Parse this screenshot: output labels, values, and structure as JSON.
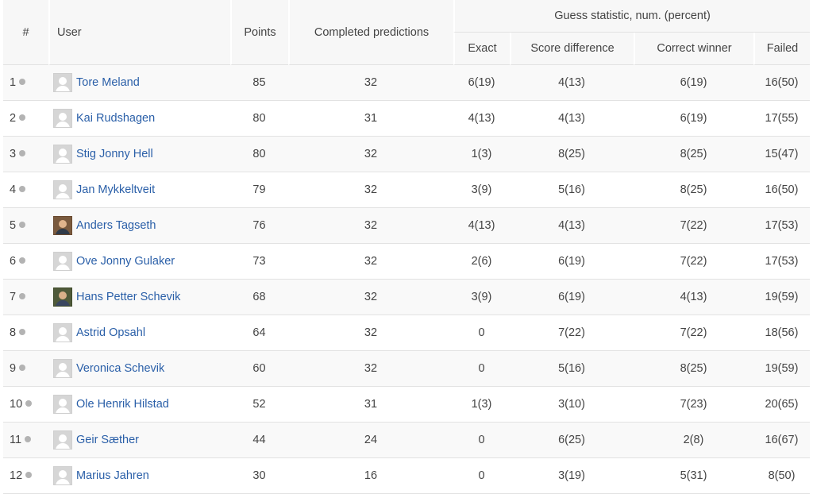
{
  "headers": {
    "rank": "#",
    "user": "User",
    "points": "Points",
    "completed": "Completed predictions",
    "group": "Guess statistic, num. (percent)",
    "exact": "Exact",
    "score_difference": "Score difference",
    "correct_winner": "Correct winner",
    "failed": "Failed"
  },
  "rows": [
    {
      "rank": "1",
      "name": "Tore Meland",
      "avatar": "default-avatar-icon",
      "points": "85",
      "completed": "32",
      "exact": "6(19)",
      "score_diff": "4(13)",
      "winner": "6(19)",
      "failed": "16(50)"
    },
    {
      "rank": "2",
      "name": "Kai Rudshagen",
      "avatar": "default-avatar-icon",
      "points": "80",
      "completed": "31",
      "exact": "4(13)",
      "score_diff": "4(13)",
      "winner": "6(19)",
      "failed": "17(55)"
    },
    {
      "rank": "3",
      "name": "Stig Jonny Hell",
      "avatar": "default-avatar-icon",
      "points": "80",
      "completed": "32",
      "exact": "1(3)",
      "score_diff": "8(25)",
      "winner": "8(25)",
      "failed": "15(47)"
    },
    {
      "rank": "4",
      "name": "Jan Mykkeltveit",
      "avatar": "default-avatar-icon",
      "points": "79",
      "completed": "32",
      "exact": "3(9)",
      "score_diff": "5(16)",
      "winner": "8(25)",
      "failed": "16(50)"
    },
    {
      "rank": "5",
      "name": "Anders Tagseth",
      "avatar": "user-photo",
      "points": "76",
      "completed": "32",
      "exact": "4(13)",
      "score_diff": "4(13)",
      "winner": "7(22)",
      "failed": "17(53)"
    },
    {
      "rank": "6",
      "name": "Ove Jonny Gulaker",
      "avatar": "default-avatar-icon",
      "points": "73",
      "completed": "32",
      "exact": "2(6)",
      "score_diff": "6(19)",
      "winner": "7(22)",
      "failed": "17(53)"
    },
    {
      "rank": "7",
      "name": "Hans Petter Schevik",
      "avatar": "user-photo-2",
      "points": "68",
      "completed": "32",
      "exact": "3(9)",
      "score_diff": "6(19)",
      "winner": "4(13)",
      "failed": "19(59)"
    },
    {
      "rank": "8",
      "name": "Astrid Opsahl",
      "avatar": "default-avatar-icon",
      "points": "64",
      "completed": "32",
      "exact": "0",
      "score_diff": "7(22)",
      "winner": "7(22)",
      "failed": "18(56)"
    },
    {
      "rank": "9",
      "name": "Veronica Schevik",
      "avatar": "default-avatar-icon",
      "points": "60",
      "completed": "32",
      "exact": "0",
      "score_diff": "5(16)",
      "winner": "8(25)",
      "failed": "19(59)"
    },
    {
      "rank": "10",
      "name": "Ole Henrik Hilstad",
      "avatar": "default-avatar-icon",
      "points": "52",
      "completed": "31",
      "exact": "1(3)",
      "score_diff": "3(10)",
      "winner": "7(23)",
      "failed": "20(65)"
    },
    {
      "rank": "11",
      "name": "Geir Sæther",
      "avatar": "default-avatar-icon",
      "points": "44",
      "completed": "24",
      "exact": "0",
      "score_diff": "6(25)",
      "winner": "2(8)",
      "failed": "16(67)"
    },
    {
      "rank": "12",
      "name": "Marius Jahren",
      "avatar": "default-avatar-icon",
      "points": "30",
      "completed": "16",
      "exact": "0",
      "score_diff": "3(19)",
      "winner": "5(31)",
      "failed": "8(50)"
    }
  ]
}
